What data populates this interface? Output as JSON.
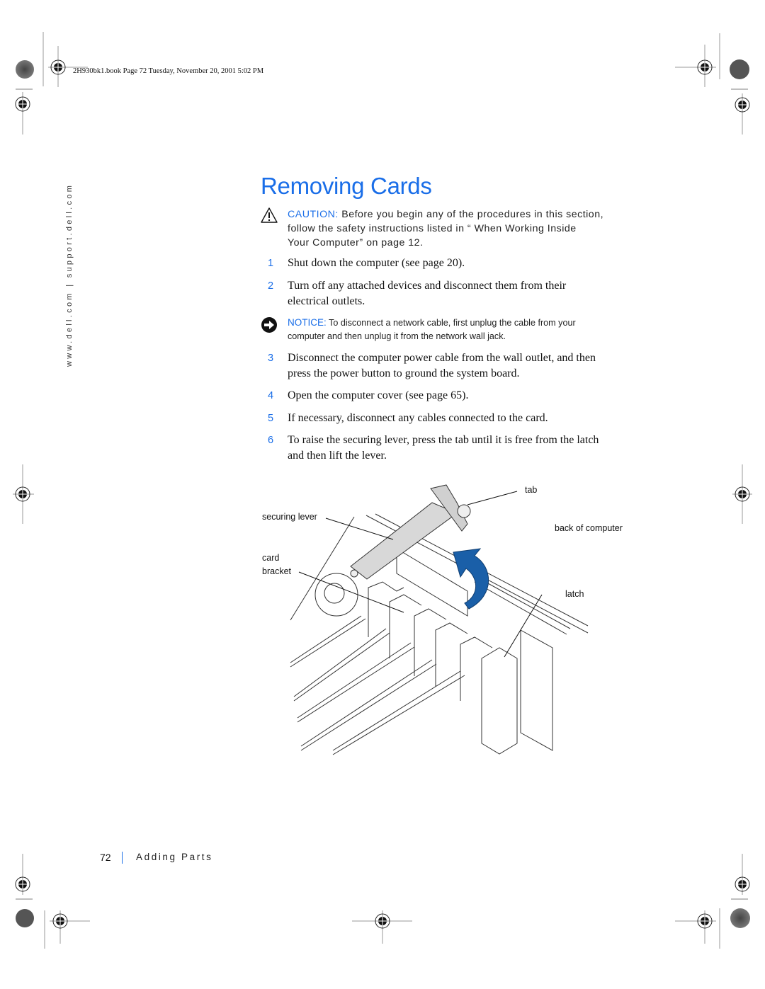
{
  "print_slug": "2H930bk1.book  Page 72  Tuesday, November 20, 2001  5:02 PM",
  "side_url": "www.dell.com  |  support.dell.com",
  "page": {
    "title": "Removing Cards",
    "caution": {
      "label": "CAUTION:",
      "icon": "warning-triangle-icon",
      "lines": [
        " Before you begin any of the procedures in this section,",
        "follow the safety instructions listed in “ When Working Inside",
        "Your Computer”  on page 12."
      ]
    },
    "steps_before_notice": [
      {
        "num": "1",
        "lines": [
          "Shut down the computer (see page 20)."
        ]
      },
      {
        "num": "2",
        "lines": [
          "Turn off any attached devices and disconnect them from their",
          "electrical outlets."
        ]
      }
    ],
    "notice": {
      "label": "NOTICE:",
      "icon": "notice-arrow-icon",
      "lines": [
        " To disconnect a network cable, first unplug the cable from your",
        "computer and then unplug it from the network wall jack."
      ]
    },
    "steps_after_notice": [
      {
        "num": "3",
        "lines": [
          "Disconnect the computer power cable from the wall outlet, and then",
          "press the power button to ground the system board."
        ]
      },
      {
        "num": "4",
        "lines": [
          "Open the computer cover (see page 65)."
        ]
      },
      {
        "num": "5",
        "lines": [
          "If necessary, disconnect any cables connected to the card."
        ]
      },
      {
        "num": "6",
        "lines": [
          "To raise the securing lever, press the tab until it is free from the latch",
          "and then lift the lever."
        ]
      }
    ],
    "figure": {
      "callouts": {
        "tab": "tab",
        "securing_lever": "securing lever",
        "back_of_computer": "back of computer",
        "card": "card",
        "bracket": "bracket",
        "latch": "latch"
      },
      "arrow_color": "#1a5fa8"
    }
  },
  "footer": {
    "page_number": "72",
    "section": "Adding Parts"
  },
  "colors": {
    "accent": "#1a6ee8",
    "text": "#1a1a1a"
  }
}
